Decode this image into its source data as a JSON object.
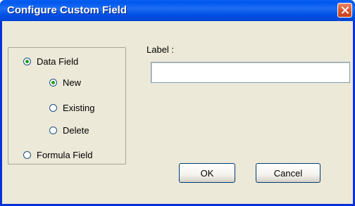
{
  "window": {
    "title": "Configure Custom Field"
  },
  "radio_group": {
    "data_field": {
      "label": "Data Field",
      "selected": true
    },
    "new": {
      "label": "New",
      "selected": true
    },
    "existing": {
      "label": "Existing",
      "selected": false
    },
    "delete": {
      "label": "Delete",
      "selected": false
    },
    "formula_field": {
      "label": "Formula Field",
      "selected": false
    }
  },
  "label_field": {
    "caption": "Label :",
    "value": "",
    "placeholder": ""
  },
  "buttons": {
    "ok": "OK",
    "cancel": "Cancel"
  },
  "colors": {
    "titlebar": "#0058ee",
    "client": "#ece9d8",
    "close_button": "#d9572f",
    "radio_dot": "#21a121"
  }
}
